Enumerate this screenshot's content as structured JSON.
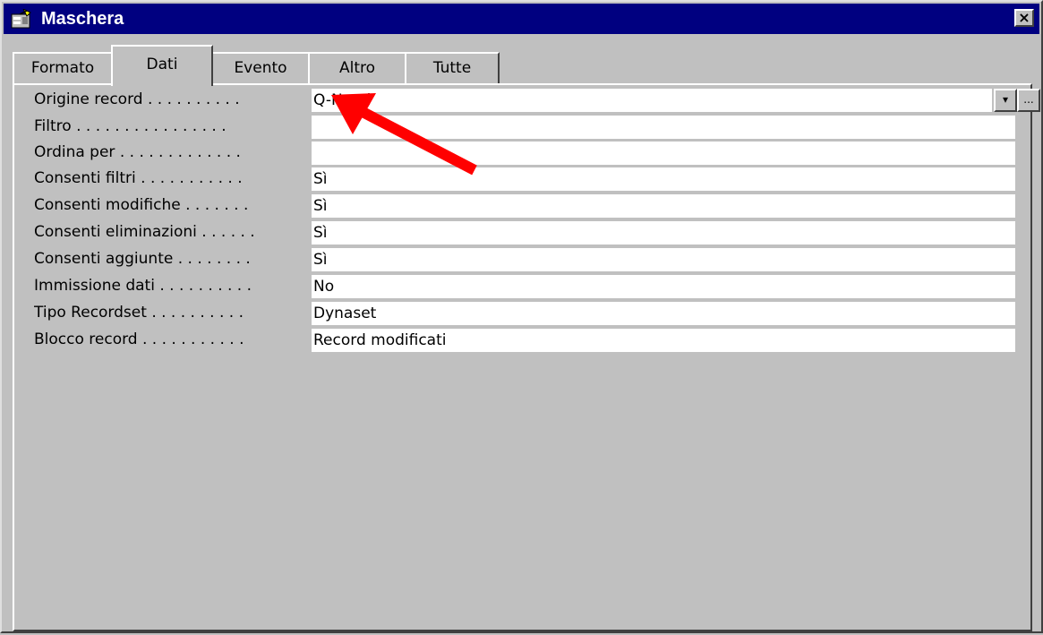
{
  "window": {
    "title": "Maschera",
    "close_glyph": "×",
    "title_icon": "form-properties-icon"
  },
  "tabs": [
    {
      "label": "Formato",
      "active": false
    },
    {
      "label": "Dati",
      "active": true
    },
    {
      "label": "Evento",
      "active": false
    },
    {
      "label": "Altro",
      "active": false
    },
    {
      "label": "Tutte",
      "active": false
    }
  ],
  "properties": [
    {
      "label": "Origine record",
      "dots": ". . . . . . . . . .",
      "value": "Q-Nomi"
    },
    {
      "label": "Filtro",
      "dots": ". . . . . . . . . . . . . . . .",
      "value": ""
    },
    {
      "label": "Ordina per",
      "dots": ". . . . . . . . . . . . .",
      "value": ""
    },
    {
      "label": "Consenti filtri",
      "dots": ". . . . . . . . . . .",
      "value": "Sì"
    },
    {
      "label": "Consenti modifiche",
      "dots": ". . . . . . .",
      "value": "Sì"
    },
    {
      "label": "Consenti eliminazioni",
      "dots": ". . . . . .",
      "value": "Sì"
    },
    {
      "label": "Consenti aggiunte",
      "dots": ". . . . . . . .",
      "value": "Sì"
    },
    {
      "label": "Immissione dati",
      "dots": ". . . . . . . . . .",
      "value": "No"
    },
    {
      "label": "Tipo Recordset",
      "dots": ". . . . . . . . . .",
      "value": "Dynaset"
    },
    {
      "label": "Blocco record",
      "dots": ". . . . . . . . . . .",
      "value": "Record modificati"
    }
  ],
  "combo": {
    "dropdown_glyph": "▾",
    "builder_glyph": "..."
  },
  "annotation": {
    "arrow_color": "#ff0000"
  },
  "colors": {
    "titlebar": "#000080",
    "face": "#c0c0c0",
    "field": "#ffffff"
  }
}
